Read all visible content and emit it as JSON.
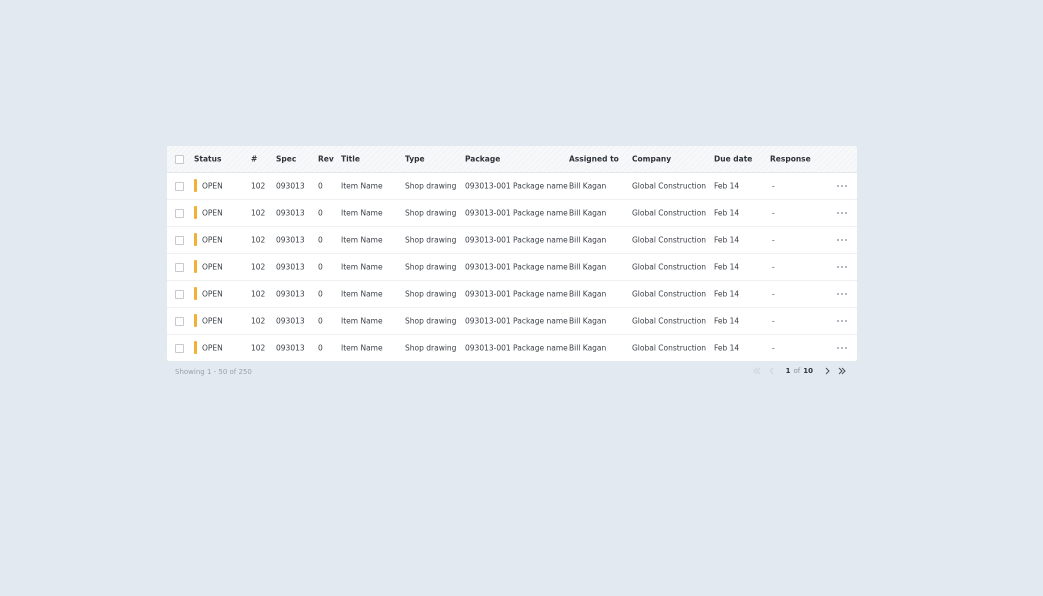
{
  "table": {
    "columns": [
      "Status",
      "#",
      "Spec",
      "Rev",
      "Title",
      "Type",
      "Package",
      "Assigned to",
      "Company",
      "Due date",
      "Response"
    ],
    "rows": [
      {
        "status": "OPEN",
        "number": "102",
        "spec": "093013",
        "rev": "0",
        "title": "Item Name",
        "type": "Shop drawing",
        "package": "093013-001 Package name",
        "assigned_to": "Bill Kagan",
        "company": "Global Construction",
        "due_date": "Feb 14",
        "response": "-"
      },
      {
        "status": "OPEN",
        "number": "102",
        "spec": "093013",
        "rev": "0",
        "title": "Item Name",
        "type": "Shop drawing",
        "package": "093013-001 Package name",
        "assigned_to": "Bill Kagan",
        "company": "Global Construction",
        "due_date": "Feb 14",
        "response": "-"
      },
      {
        "status": "OPEN",
        "number": "102",
        "spec": "093013",
        "rev": "0",
        "title": "Item Name",
        "type": "Shop drawing",
        "package": "093013-001 Package name",
        "assigned_to": "Bill Kagan",
        "company": "Global Construction",
        "due_date": "Feb 14",
        "response": "-"
      },
      {
        "status": "OPEN",
        "number": "102",
        "spec": "093013",
        "rev": "0",
        "title": "Item Name",
        "type": "Shop drawing",
        "package": "093013-001 Package name",
        "assigned_to": "Bill Kagan",
        "company": "Global Construction",
        "due_date": "Feb 14",
        "response": "-"
      },
      {
        "status": "OPEN",
        "number": "102",
        "spec": "093013",
        "rev": "0",
        "title": "Item Name",
        "type": "Shop drawing",
        "package": "093013-001 Package name",
        "assigned_to": "Bill Kagan",
        "company": "Global Construction",
        "due_date": "Feb 14",
        "response": "-"
      },
      {
        "status": "OPEN",
        "number": "102",
        "spec": "093013",
        "rev": "0",
        "title": "Item Name",
        "type": "Shop drawing",
        "package": "093013-001 Package name",
        "assigned_to": "Bill Kagan",
        "company": "Global Construction",
        "due_date": "Feb 14",
        "response": "-"
      },
      {
        "status": "OPEN",
        "number": "102",
        "spec": "093013",
        "rev": "0",
        "title": "Item Name",
        "type": "Shop drawing",
        "package": "093013-001 Package name",
        "assigned_to": "Bill Kagan",
        "company": "Global Construction",
        "due_date": "Feb 14",
        "response": "-"
      }
    ]
  },
  "footer": {
    "showing_text": "Showing 1 - 50 of 250",
    "page_current": "1",
    "page_of": "of",
    "page_total": "10"
  },
  "icons": {
    "row_actions": "more-horizontal-icon",
    "first_page": "chevrons-left-icon",
    "prev_page": "chevron-left-icon",
    "next_page": "chevron-right-icon",
    "last_page": "chevrons-right-icon"
  },
  "colors": {
    "background": "#e2e9f0",
    "status_open": "#f2b134",
    "text": "#3c4148",
    "muted_text": "#9aa1a8"
  }
}
